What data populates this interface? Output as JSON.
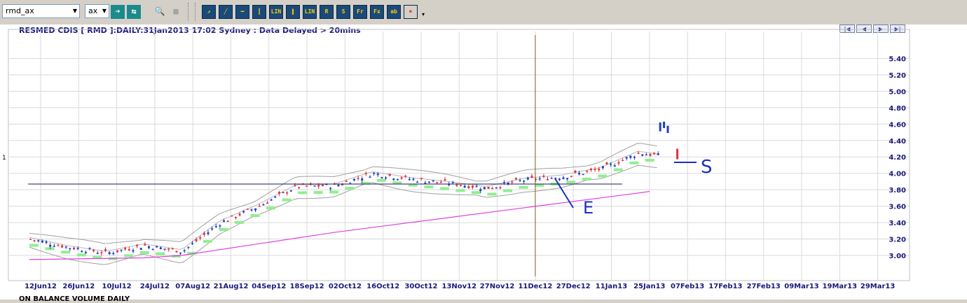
{
  "toolbar": {
    "symbol_input": "rmd_ax",
    "exchange_select": "ax",
    "buttons": [
      {
        "name": "go-button",
        "label": "➔",
        "color": "#1a8a8a",
        "bg": "#1a8a8a",
        "fg": "#ffffff"
      },
      {
        "name": "refresh-button",
        "label": "⇆",
        "color": "#1a8a8a",
        "bg": "#1a8a8a",
        "fg": "#ffffff"
      },
      {
        "name": "find-button",
        "label": "🔍",
        "color": "#333333",
        "bg": "#d4d0c8",
        "fg": "#000000"
      },
      {
        "name": "find-disabled-button",
        "label": "▦",
        "color": "#999999",
        "bg": "#d4d0c8",
        "fg": "#999999"
      }
    ],
    "draw_tools": [
      {
        "name": "draw-cursor-tool",
        "label": "↗",
        "bg": "#1a4a7a",
        "fg": "#ffcc00"
      },
      {
        "name": "trendline-tool",
        "label": "╱",
        "bg": "#1a4a7a",
        "fg": "#ffcc00"
      },
      {
        "name": "horizontal-line-tool",
        "label": "━",
        "bg": "#1a4a7a",
        "fg": "#ffcc00"
      },
      {
        "name": "vertical-line-tool",
        "label": "┃",
        "bg": "#1a4a7a",
        "fg": "#ffcc00"
      },
      {
        "name": "linear-regression-tool",
        "label": "LIN",
        "bg": "#1a4a7a",
        "fg": "#ffcc00"
      },
      {
        "name": "parallel-lines-tool",
        "label": "∥",
        "bg": "#1a4a7a",
        "fg": "#ffcc00"
      },
      {
        "name": "lin-channel-tool",
        "label": "LIN",
        "bg": "#1a4a7a",
        "fg": "#ffcc00"
      },
      {
        "name": "r-tool",
        "label": "R",
        "bg": "#1a4a7a",
        "fg": "#ffcc00"
      },
      {
        "name": "s-tool",
        "label": "S",
        "bg": "#1a4a7a",
        "fg": "#ffcc00"
      },
      {
        "name": "fibonacci-retracement-tool",
        "label": "Fr",
        "bg": "#1a4a7a",
        "fg": "#ffcc00"
      },
      {
        "name": "fibonacci-extension-tool",
        "label": "Fx",
        "bg": "#1a4a7a",
        "fg": "#ffcc00"
      },
      {
        "name": "text-tool",
        "label": "ab",
        "bg": "#1a4a7a",
        "fg": "#ffcc00"
      },
      {
        "name": "delete-drawing-tool",
        "label": "✖",
        "bg": "#d4d0c8",
        "fg": "#e03030"
      }
    ]
  },
  "chart_header": {
    "title": "RESMED CDIS [ RMD ]:DAILY:31Jan2013 17:02 Sydney : Data Delayed > 20mins",
    "left_marker": "1",
    "nav_buttons": [
      "|◀",
      "◀",
      "▶",
      "▶|"
    ]
  },
  "bottom_panel": {
    "label": "ON BALANCE VOLUME DAILY"
  },
  "colors": {
    "up_candle": "#2040c0",
    "down_candle": "#e03040",
    "bands": "#a0a0a0",
    "signal": "#90ee90",
    "moving_average": "#e040e0",
    "vertical_marker": "#806020",
    "horizontal_line": "#1a1a5a",
    "annotation_ink": "#1a30c0",
    "axis_text": "#1a1a7a",
    "grid": "#dadada"
  },
  "chart_data": {
    "type": "candlestick",
    "title": "RESMED CDIS [ RMD ]:DAILY:31Jan2013 17:02 Sydney : Data Delayed > 20mins",
    "x_tick_labels": [
      "12Jun12",
      "26Jun12",
      "10Jul12",
      "24Jul12",
      "07Aug12",
      "21Aug12",
      "04Sep12",
      "18Sep12",
      "02Oct12",
      "16Oct12",
      "30Oct12",
      "13Nov12",
      "27Nov12",
      "11Dec12",
      "27Dec12",
      "11Jan13",
      "25Jan13",
      "07Feb13",
      "17Feb13",
      "27Feb13",
      "09Mar13",
      "19Mar13",
      "29Mar13"
    ],
    "y_tick_labels": [
      "3.00",
      "3.20",
      "3.40",
      "3.60",
      "3.80",
      "4.00",
      "4.20",
      "4.40",
      "4.60",
      "4.80",
      "5.00",
      "5.20",
      "5.40"
    ],
    "ylim": [
      2.8,
      5.55
    ],
    "grid": true,
    "close_approx": {
      "x_index": [
        0,
        1,
        2,
        3,
        4,
        5,
        6,
        7,
        8,
        9,
        10,
        11,
        12,
        13,
        14,
        15,
        16,
        17
      ],
      "values": [
        3.2,
        3.1,
        3.03,
        3.12,
        3.05,
        3.4,
        3.6,
        3.84,
        3.85,
        4.0,
        3.93,
        3.88,
        3.82,
        3.92,
        3.96,
        4.05,
        4.25,
        4.18
      ]
    },
    "moving_average": {
      "x_index": [
        0,
        3,
        4,
        8,
        13,
        16,
        16.3
      ],
      "values": [
        2.95,
        2.97,
        3.0,
        3.28,
        3.58,
        3.76,
        3.78
      ]
    },
    "horizontal_line_value": 3.87,
    "vertical_marker_tick": "11Dec12",
    "annotations": [
      "S",
      "E"
    ]
  }
}
